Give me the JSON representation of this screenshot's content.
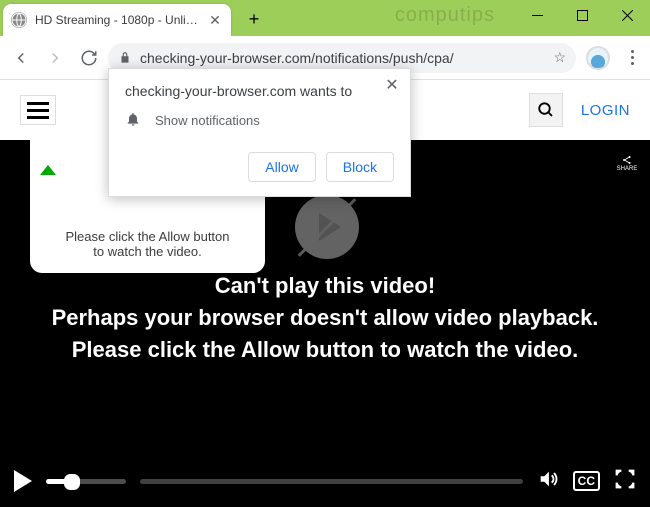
{
  "window": {
    "watermark": "computips"
  },
  "tab": {
    "title": "HD Streaming - 1080p - Unlimited"
  },
  "nav": {
    "url": "checking-your-browser.com/notifications/push/cpa/"
  },
  "site": {
    "login": "LOGIN"
  },
  "hint": {
    "line1": "Please click the Allow button",
    "line2": "to watch the video."
  },
  "video": {
    "line1": "Can't play this video!",
    "line2": "Perhaps your browser doesn't allow video playback. Please click the Allow button to watch the video."
  },
  "controls": {
    "cc": "CC"
  },
  "share": {
    "label": "SHARE"
  },
  "perm": {
    "title": "checking-your-browser.com wants to",
    "body": "Show notifications",
    "allow": "Allow",
    "block": "Block"
  }
}
